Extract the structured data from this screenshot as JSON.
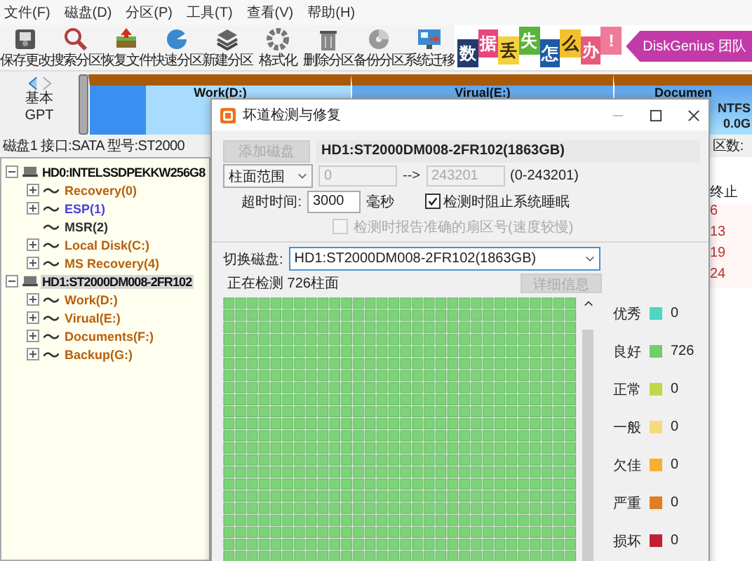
{
  "menu": [
    "文件(F)",
    "磁盘(D)",
    "分区(P)",
    "工具(T)",
    "查看(V)",
    "帮助(H)"
  ],
  "toolbar": [
    {
      "label": "保存更改",
      "kind": "save"
    },
    {
      "label": "搜索分区",
      "kind": "search"
    },
    {
      "label": "恢复文件",
      "kind": "restore"
    },
    {
      "label": "快速分区",
      "kind": "quick"
    },
    {
      "label": "新建分区",
      "kind": "new"
    },
    {
      "label": "格式化",
      "kind": "format"
    },
    {
      "label": "删除分区",
      "kind": "delete"
    },
    {
      "label": "备份分区",
      "kind": "backup"
    },
    {
      "label": "系统迁移",
      "kind": "migrate"
    }
  ],
  "banner": {
    "tiles": [
      {
        "char": "数",
        "color": "#233c6e"
      },
      {
        "char": "据",
        "color": "#e8467c"
      },
      {
        "char": "丢",
        "color": "#f3d23c"
      },
      {
        "char": "失",
        "color": "#5bb33c"
      },
      {
        "char": "怎",
        "color": "#1f5aa6"
      },
      {
        "char": "么",
        "color": "#f2c12e"
      },
      {
        "char": "办",
        "color": "#e85a7c"
      },
      {
        "char": "!",
        "color": "#f07a9a"
      }
    ],
    "slogan": "DiskGenius 团队"
  },
  "disk_map": {
    "type_labels": [
      "基本",
      "GPT"
    ],
    "segments": [
      {
        "label": "Work(D:)"
      },
      {
        "label": "Virual(E:)"
      },
      {
        "label": "Documen",
        "details": [
          "NTFS",
          "0.0G"
        ]
      }
    ]
  },
  "disk_info": "磁盘1 接口:SATA 型号:ST2000",
  "side_panel": {
    "header": "区数:",
    "column": "终止",
    "values": [
      "6",
      "13",
      "19",
      "24"
    ]
  },
  "tree": [
    {
      "label": "HD0:INTELSSDPEKKW256G8",
      "expanded": true,
      "selected": false,
      "children": [
        {
          "label": "Recovery(0)",
          "color": "#b8600b",
          "expandable": true
        },
        {
          "label": "ESP(1)",
          "color": "#4a3ee0",
          "expandable": true
        },
        {
          "label": "MSR(2)",
          "color": "#303030",
          "expandable": false
        },
        {
          "label": "Local Disk(C:)",
          "color": "#b8600b",
          "expandable": true
        },
        {
          "label": "MS Recovery(4)",
          "color": "#b8600b",
          "expandable": true
        }
      ]
    },
    {
      "label": "HD1:ST2000DM008-2FR102",
      "expanded": true,
      "selected": true,
      "children": [
        {
          "label": "Work(D:)",
          "color": "#b8600b",
          "expandable": true
        },
        {
          "label": "Virual(E:)",
          "color": "#b8600b",
          "expandable": true
        },
        {
          "label": "Documents(F:)",
          "color": "#b8600b",
          "expandable": true
        },
        {
          "label": "Backup(G:)",
          "color": "#b8600b",
          "expandable": true
        }
      ]
    }
  ],
  "dialog": {
    "title": "坏道检测与修复",
    "add_button": {
      "label": "添加磁盘",
      "disabled": true
    },
    "disk_field": "HD1:ST2000DM008-2FR102(1863GB)",
    "range": {
      "mode": "柱面范围",
      "start": "0",
      "arrow": "-->",
      "end": "243201",
      "hint": "(0-243201)",
      "disabled": true
    },
    "timeout": {
      "label": "超时时间:",
      "value": "3000",
      "unit": "毫秒"
    },
    "options": [
      {
        "label": "检测时阻止系统睡眠",
        "checked": true,
        "disabled": false
      },
      {
        "label": "检测时报告准确的扇区号(速度较慢)",
        "checked": false,
        "disabled": true
      }
    ],
    "switch_disk": {
      "label": "切换磁盘:",
      "value": "HD1:ST2000DM008-2FR102(1863GB)"
    },
    "status": "正在检测 726柱面",
    "details_button": {
      "label": "详细信息",
      "disabled": true
    },
    "legend": [
      {
        "label": "优秀",
        "color": "#4fd6c0",
        "count": "0"
      },
      {
        "label": "良好",
        "color": "#6fcf6f",
        "count": "726"
      },
      {
        "label": "正常",
        "color": "#c2d64a",
        "count": "0"
      },
      {
        "label": "一般",
        "color": "#f5dc7a",
        "count": "0"
      },
      {
        "label": "欠佳",
        "color": "#f5b030",
        "count": "0"
      },
      {
        "label": "严重",
        "color": "#e08020",
        "count": "0"
      },
      {
        "label": "损坏",
        "color": "#c02030",
        "count": "0"
      }
    ]
  }
}
